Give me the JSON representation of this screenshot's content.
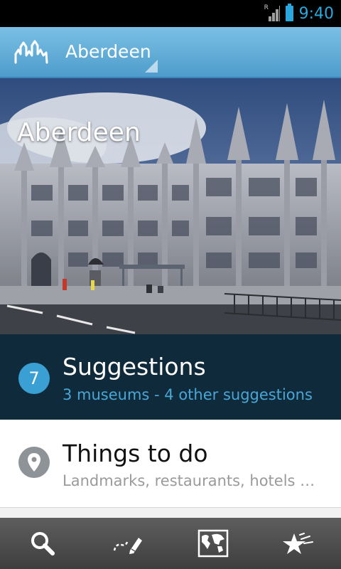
{
  "status_bar": {
    "time": "9:40",
    "roaming_indicator": "R",
    "icons": [
      "signal-icon",
      "battery-icon"
    ],
    "accent_color": "#2aa8de"
  },
  "action_bar": {
    "logo_icon": "city-skyline-icon",
    "title": "Aberdeen",
    "dropdown_icon": "dropdown-corner-icon",
    "colors": {
      "top": "#7ac0e4",
      "bottom": "#4e9ccc"
    }
  },
  "hero": {
    "title": "Aberdeen"
  },
  "suggestions": {
    "count": "7",
    "title": "Suggestions",
    "subtitle": "3 museums - 4 other suggestions",
    "background": "#0f2a3a",
    "accent": "#3aa0d4"
  },
  "things_to_do": {
    "icon": "location-pin-icon",
    "title": "Things to do",
    "subtitle": "Landmarks, restaurants, hotels …"
  },
  "bottom_nav": {
    "tabs": [
      {
        "icon": "search-icon"
      },
      {
        "icon": "edit-route-icon"
      },
      {
        "icon": "world-map-icon"
      },
      {
        "icon": "favorites-stars-icon"
      }
    ]
  }
}
